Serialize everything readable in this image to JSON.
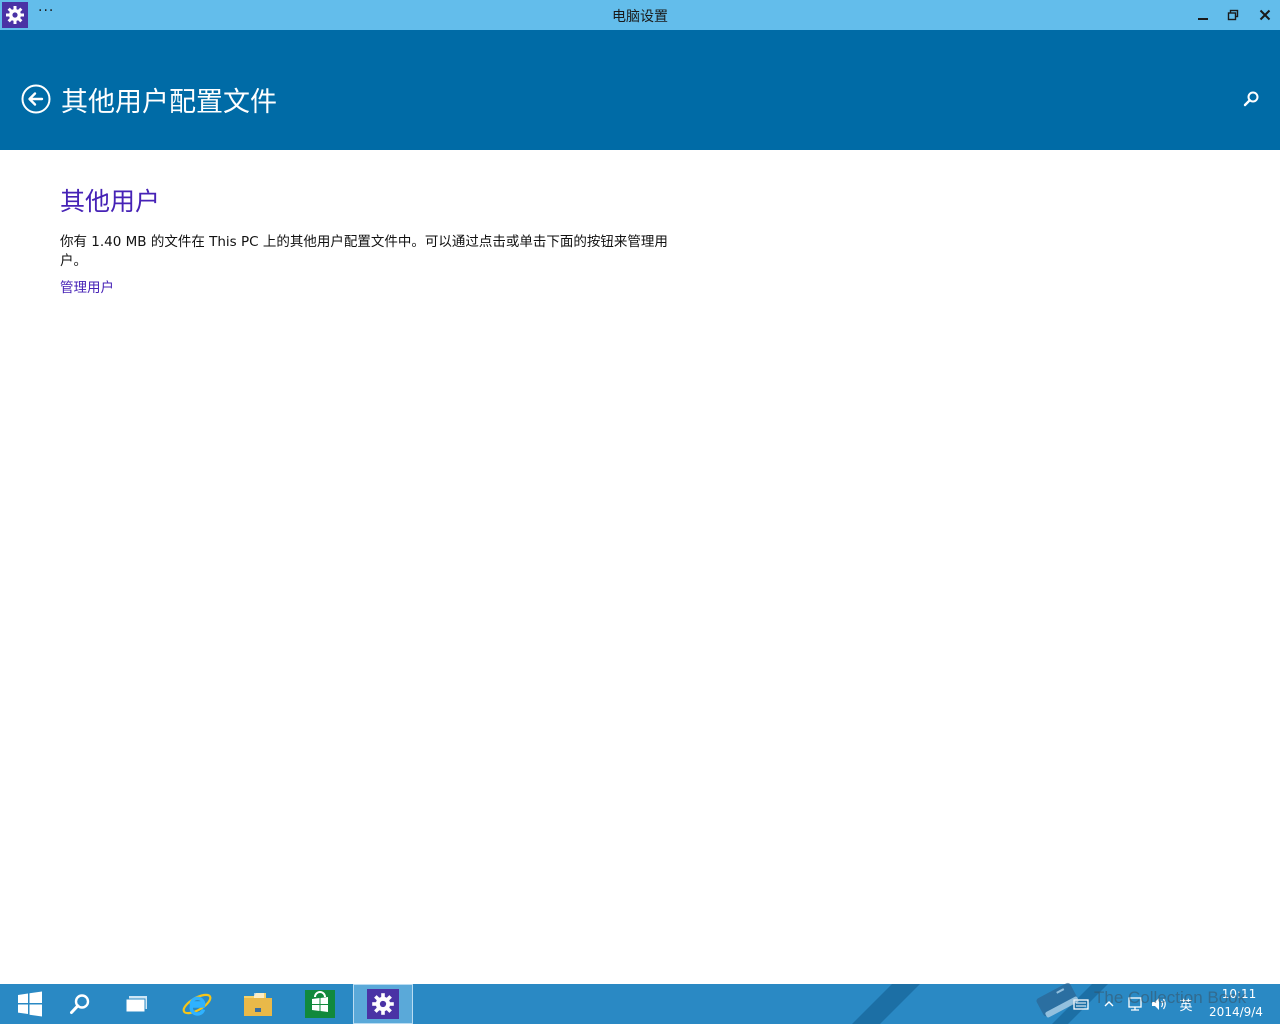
{
  "window": {
    "title": "电脑设置",
    "more_label": "···",
    "app_icon": "gear-icon",
    "controls": [
      "minimize-icon",
      "restore-icon",
      "close-icon"
    ]
  },
  "header": {
    "back_icon": "back-arrow-icon",
    "title": "其他用户配置文件",
    "search_icon": "search-icon"
  },
  "content": {
    "heading": "其他用户",
    "description": "你有 1.40 MB 的文件在 This PC 上的其他用户配置文件中。可以通过点击或单击下面的按钮来管理用户。",
    "link": "管理用户"
  },
  "taskbar": {
    "buttons": [
      {
        "name": "start-button",
        "icon": "windows-logo-icon"
      },
      {
        "name": "search-button",
        "icon": "search-icon"
      },
      {
        "name": "task-view-button",
        "icon": "task-view-icon"
      },
      {
        "name": "internet-explorer-button",
        "icon": "ie-icon"
      },
      {
        "name": "file-explorer-button",
        "icon": "folder-icon"
      },
      {
        "name": "store-button",
        "icon": "store-icon"
      },
      {
        "name": "pc-settings-button",
        "icon": "gear-icon",
        "active": true
      }
    ],
    "tray": {
      "icons": [
        "keyboard-icon",
        "show-hidden-icons-icon",
        "network-icon",
        "volume-icon"
      ],
      "ime_label": "英",
      "time": "10:11",
      "date": "2014/9/4"
    },
    "watermark": "The Collection Book"
  },
  "colors": {
    "titlebar": "#63bdeb",
    "header": "#006ba6",
    "accent_text": "#4622b6",
    "taskbar": "#2a89c4",
    "app_icon_bg": "#4a33a5"
  }
}
